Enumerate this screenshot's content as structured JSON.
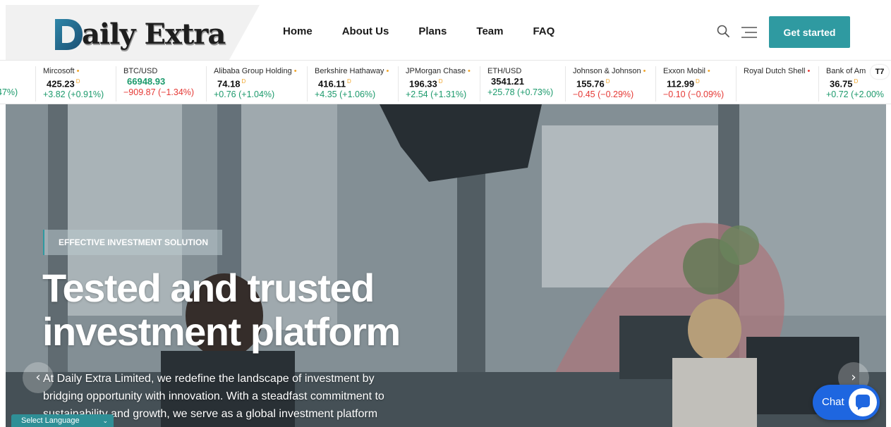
{
  "brand": {
    "name": "aily Extra",
    "initial": "D"
  },
  "nav": {
    "items": [
      {
        "label": "Home"
      },
      {
        "label": "About Us"
      },
      {
        "label": "Plans"
      },
      {
        "label": "Team"
      },
      {
        "label": "FAQ"
      }
    ],
    "cta_label": "Get started"
  },
  "ticker": {
    "partial_left_change": "47%)",
    "items": [
      {
        "name": "Mircosoft",
        "marker": "•",
        "price": "425.23",
        "flag": "D",
        "change": "+3.82 (+0.91%)"
      },
      {
        "name": "BTC/USD",
        "marker": "",
        "price": "66948.93",
        "flag": "",
        "change": "−909.87 (−1.34%)"
      },
      {
        "name": "Alibaba Group Holding",
        "marker": "•",
        "price": "74.18",
        "flag": "D",
        "change": "+0.76 (+1.04%)"
      },
      {
        "name": "Berkshire Hathaway",
        "marker": "•",
        "price": "416.11",
        "flag": "D",
        "change": "+4.35 (+1.06%)"
      },
      {
        "name": "JPMorgan Chase",
        "marker": "•",
        "price": "196.33",
        "flag": "D",
        "change": "+2.54 (+1.31%)"
      },
      {
        "name": "ETH/USD",
        "marker": "",
        "price": "3541.21",
        "flag": "",
        "change": "+25.78 (+0.73%)"
      },
      {
        "name": "Johnson & Johnson",
        "marker": "•",
        "price": "155.76",
        "flag": "D",
        "change": "−0.45 (−0.29%)"
      },
      {
        "name": "Exxon Mobil",
        "marker": "•",
        "price": "112.99",
        "flag": "D",
        "change": "−0.10 (−0.09%)"
      },
      {
        "name": "Royal Dutch Shell",
        "marker": "•",
        "price": "",
        "flag": "",
        "change": ""
      },
      {
        "name": "Bank of Am",
        "marker": "",
        "price": "36.75",
        "flag": "D",
        "change": "+0.72 (+2.00%"
      }
    ],
    "widget_logo": "TV"
  },
  "hero": {
    "eyebrow": "EFFECTIVE INVESTMENT SOLUTION",
    "title": "Tested and trusted investment platform",
    "body": "At Daily Extra Limited, we redefine the landscape of investment by bridging opportunity with innovation. With a steadfast commitment to sustainability and growth, we serve as a global investment platform",
    "prev_arrow": "‹",
    "next_arrow": "›"
  },
  "language": {
    "label": "Select Language",
    "chevron": "⌄"
  },
  "chat": {
    "label": "Chat"
  },
  "colors": {
    "accent": "#2f9aa1",
    "up": "#1c9a6c",
    "down": "#e53935",
    "chat": "#1e66e0"
  }
}
